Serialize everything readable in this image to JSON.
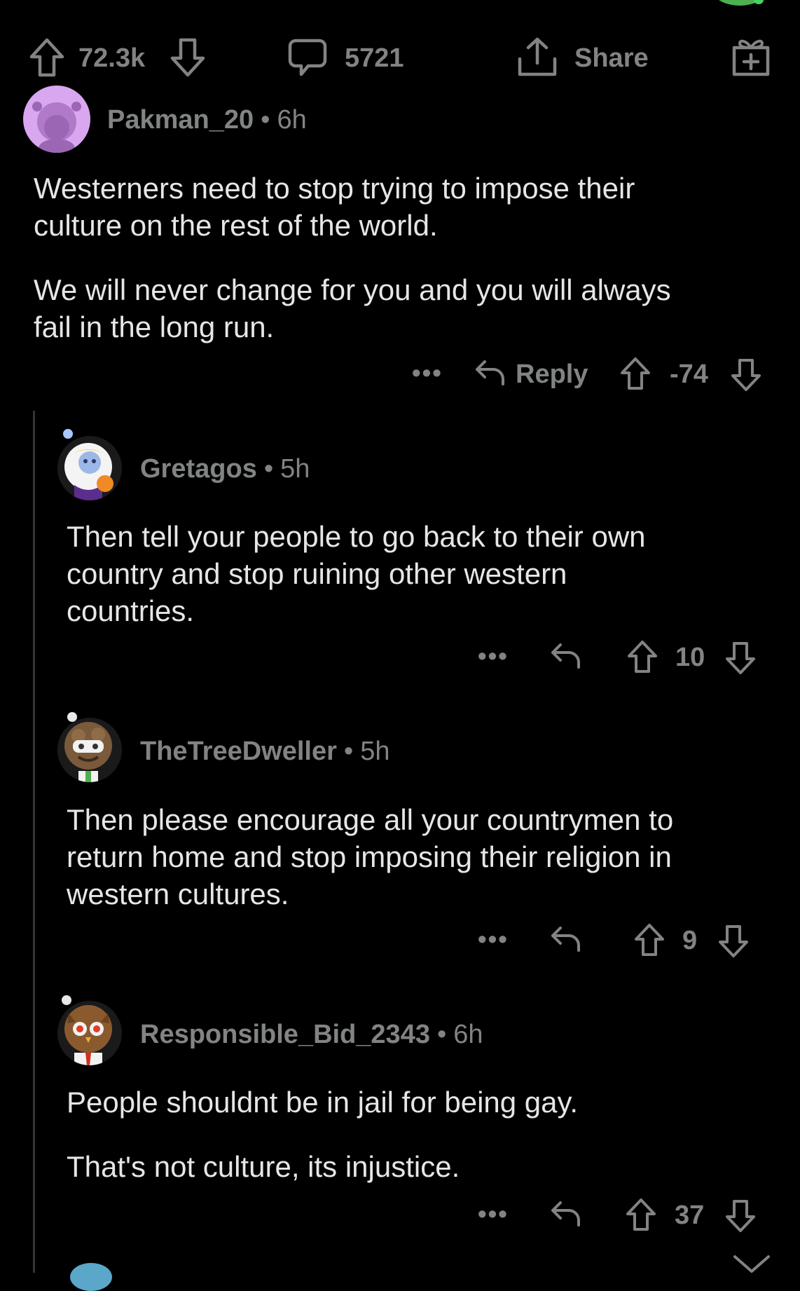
{
  "post_actions": {
    "upvotes": "72.3k",
    "comments": "5721",
    "share_label": "Share"
  },
  "comments": [
    {
      "username": "Pakman_20",
      "age": "6h",
      "paragraphs": [
        "Westerners need to stop trying to impose their\nculture on the rest of the world.",
        "We will never change for you and you will always\nfail in the long run."
      ],
      "reply_label": "Reply",
      "score": "-74"
    },
    {
      "username": "Gretagos",
      "age": "5h",
      "paragraphs": [
        "Then tell your people to go back to their own\ncountry and stop ruining other western\ncountries."
      ],
      "score": "10"
    },
    {
      "username": "TheTreeDweller",
      "age": "5h",
      "paragraphs": [
        "Then please encourage all your countrymen to\nreturn home and stop imposing their religion in\nwestern cultures."
      ],
      "score": "9"
    },
    {
      "username": "Responsible_Bid_2343",
      "age": "6h",
      "paragraphs": [
        "People shouldnt be in jail for being gay.",
        "That's not culture, its injustice."
      ],
      "score": "37"
    }
  ],
  "icons": {
    "upvote": "arrow-up-outline",
    "downvote": "arrow-down-outline",
    "comment": "speech-bubble",
    "share": "upload-arrow",
    "award": "gift-box",
    "reply": "curved-back-arrow",
    "more": "ellipsis",
    "collapse": "chevron-down"
  },
  "colors": {
    "background": "#000000",
    "text": "#e6e6e6",
    "muted": "#818384",
    "thread_line": "#343536",
    "avatar_purple": "#d9a6f0"
  }
}
